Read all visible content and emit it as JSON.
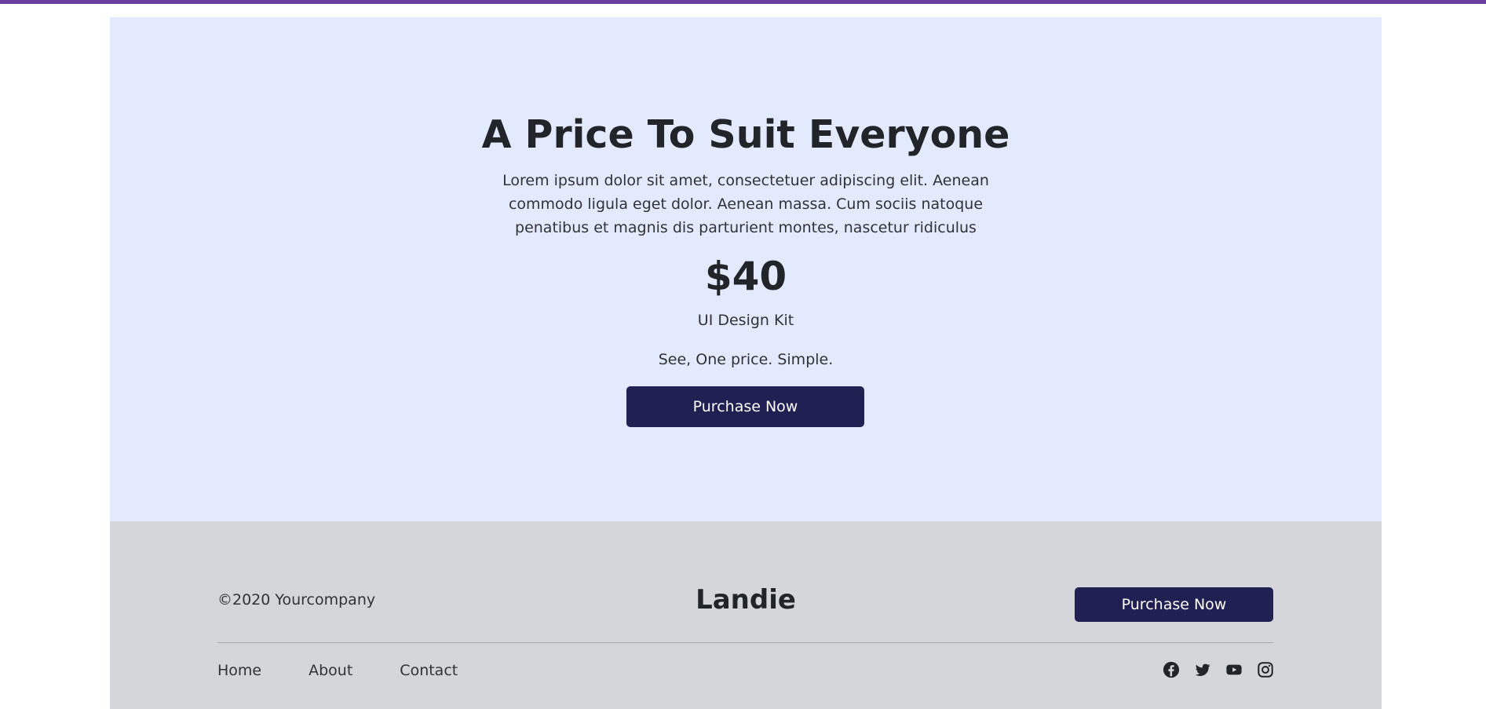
{
  "accent_color": "#6b3fa0",
  "pricing": {
    "title": "A Price To Suit Everyone",
    "description": "Lorem ipsum dolor sit amet, consectetuer adipiscing elit. Aenean commodo ligula eget dolor. Aenean massa. Cum sociis natoque penatibus et magnis dis parturient montes, nascetur ridiculus",
    "price": "$40",
    "product": "UI Design Kit",
    "tagline": "See, One price. Simple.",
    "button_label": "Purchase Now",
    "background": "#e4eafd",
    "button_color": "#212052"
  },
  "footer": {
    "copyright": "©2020 Yourcompany",
    "brand": "Landie",
    "button_label": "Purchase Now",
    "background": "#d5d6da",
    "nav": [
      {
        "label": "Home"
      },
      {
        "label": "About"
      },
      {
        "label": "Contact"
      }
    ],
    "social": [
      {
        "icon": "facebook-icon"
      },
      {
        "icon": "twitter-icon"
      },
      {
        "icon": "youtube-icon"
      },
      {
        "icon": "instagram-icon"
      }
    ]
  }
}
